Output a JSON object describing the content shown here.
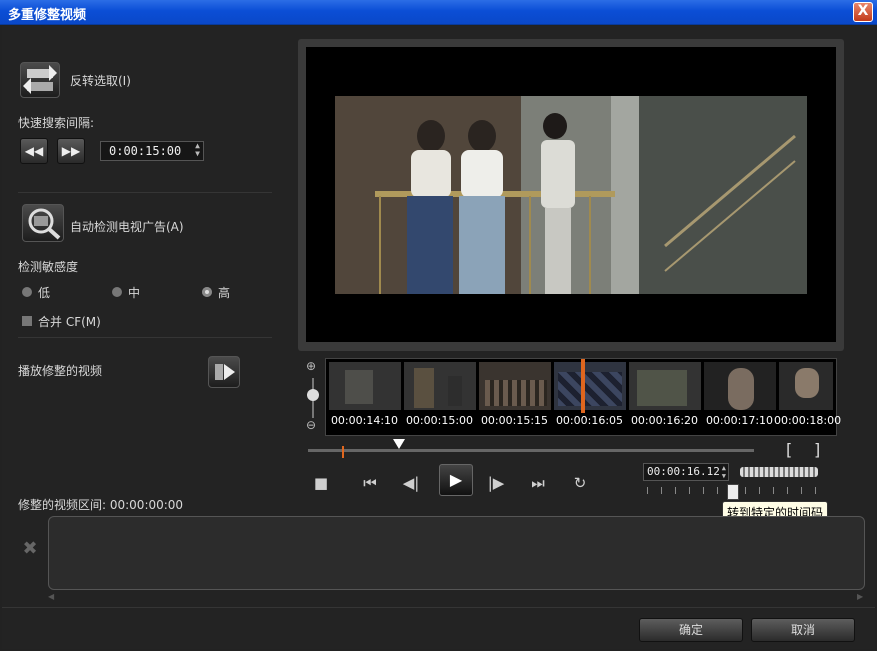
{
  "window": {
    "title": "多重修整视频",
    "close_label": "X"
  },
  "left": {
    "invert_label": "反转选取(I)",
    "fast_search_label": "快速搜索间隔:",
    "rewind_label": "◀◀",
    "forward_label": "▶▶",
    "interval_value": "0:00:15:00",
    "detect_ads_label": "自动检测电视广告(A)",
    "sensitivity_label": "检测敏感度",
    "sens_low": "低",
    "sens_mid": "中",
    "sens_high": "高",
    "selected_sensitivity": "高",
    "merge_cf_label": "合并 CF(M)",
    "play_trimmed_label": "播放修整的视频",
    "trimmed_range_label": "修整的视频区间: 00:00:00:00"
  },
  "timeline": {
    "thumb_times": [
      "00:00:14:10",
      "00:00:15:00",
      "00:00:15:15",
      "00:00:16:05",
      "00:00:16:20",
      "00:00:17:10",
      "00:00:18:00"
    ],
    "current_timecode": "00:00:16.12",
    "tooltip": "转到特定的时间码"
  },
  "controls": {
    "stop_icon": "stop-icon",
    "start_icon": "go-start-icon",
    "prev_frame_icon": "prev-frame-icon",
    "play_icon": "play-icon",
    "next_frame_icon": "next-frame-icon",
    "end_icon": "go-end-icon",
    "repeat_icon": "repeat-icon"
  },
  "footer": {
    "ok_label": "确定",
    "cancel_label": "取消"
  },
  "colors": {
    "accent_orange": "#e0661e",
    "titlebar_blue": "#0b4ed6"
  }
}
